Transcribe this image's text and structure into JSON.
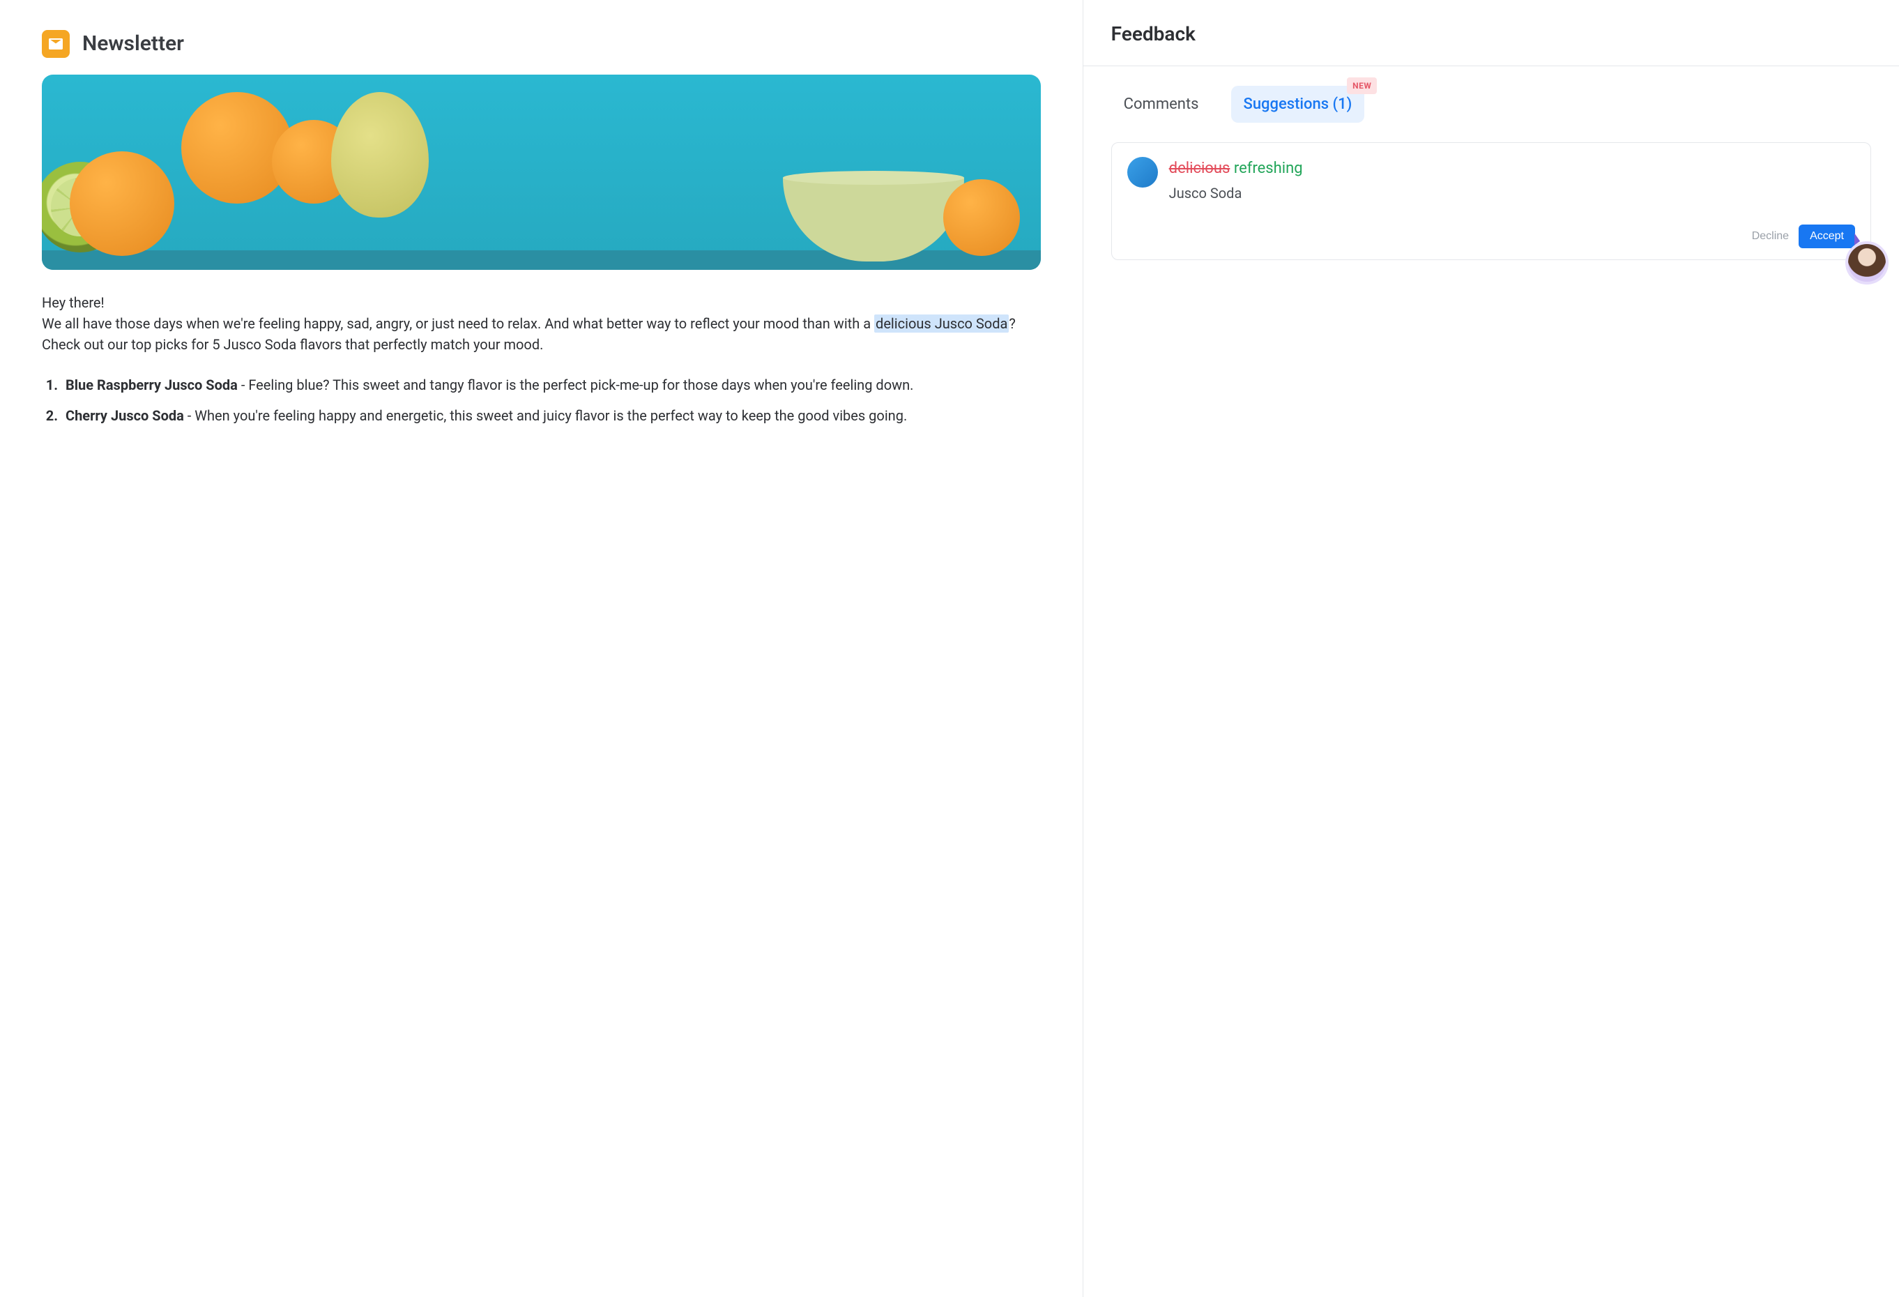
{
  "document": {
    "title": "Newsletter",
    "hero_alt": "Bowl of oranges, a lemon, and a halved lime on a turquoise background",
    "greeting": "Hey there!",
    "paragraph_before_highlight": "We all have those days when we're feeling happy, sad, angry, or just need to relax. And what better way to reflect your mood than with a ",
    "highlighted_text": "delicious Jusco Soda",
    "paragraph_after_highlight": "? Check out our top picks for 5 Jusco Soda flavors that perfectly match your mood.",
    "picks": [
      {
        "name": "Blue Raspberry Jusco Soda",
        "description": " - Feeling blue? This sweet and tangy flavor is the perfect pick-me-up for those days when you're feeling down."
      },
      {
        "name": "Cherry Jusco Soda",
        "description": " - When you're feeling happy and energetic, this sweet and juicy flavor is the perfect way to keep the good vibes going."
      }
    ]
  },
  "feedback": {
    "panel_title": "Feedback",
    "tabs": {
      "comments_label": "Comments",
      "suggestions_label": "Suggestions (1)",
      "suggestions_badge": "NEW"
    },
    "suggestion": {
      "removed": "delicious",
      "added": "refreshing",
      "context": "Jusco Soda",
      "decline_label": "Decline",
      "accept_label": "Accept"
    }
  }
}
